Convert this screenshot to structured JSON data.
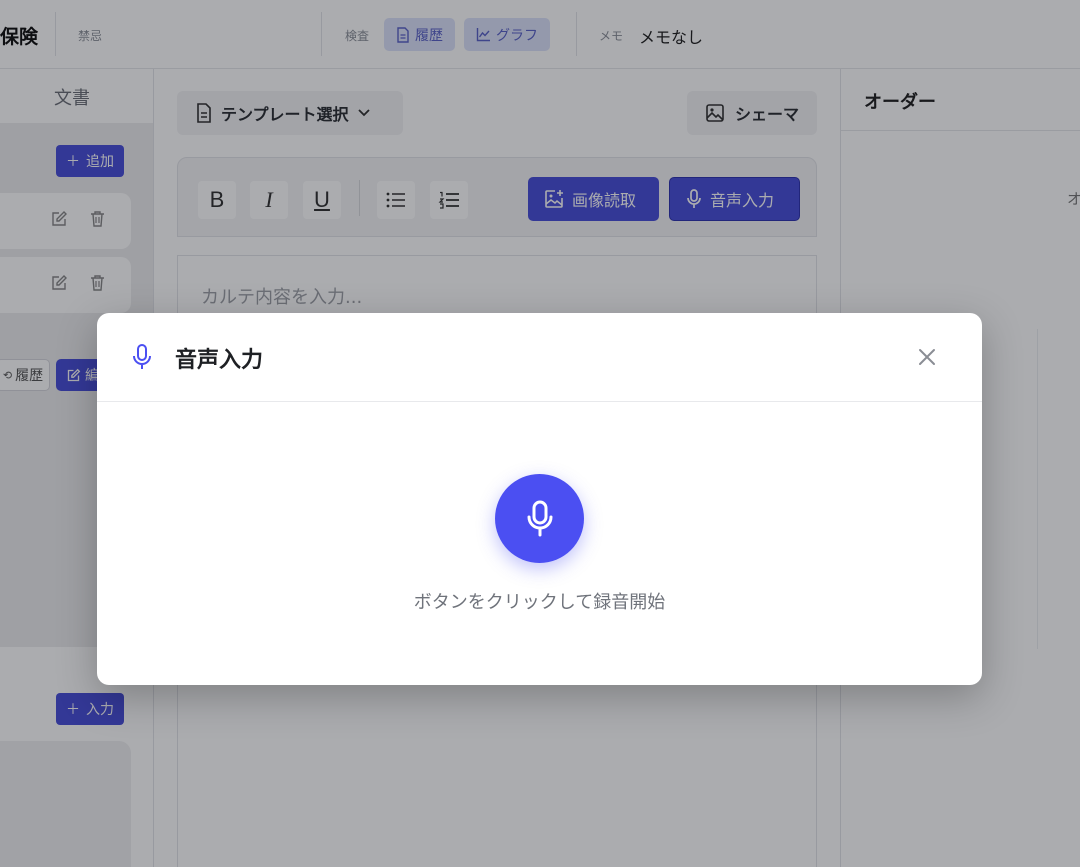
{
  "header": {
    "title": "保険",
    "tag": "禁忌",
    "exam_label": "検査",
    "chips": [
      {
        "label": "履歴",
        "icon": "document-icon"
      },
      {
        "label": "グラフ",
        "icon": "line-chart-icon"
      }
    ],
    "memo_label": "メモ",
    "memo_value": "メモなし"
  },
  "left": {
    "tab": "文書",
    "add_label": "追加",
    "history_label": "履歴",
    "edit_label": "編",
    "input_label": "入力"
  },
  "editor": {
    "template_label": "テンプレート選択",
    "schema_label": "シェーマ",
    "format_buttons": [
      "B",
      "I",
      "U"
    ],
    "image_read_label": "画像読取",
    "voice_input_label": "音声入力",
    "placeholder": "カルテ内容を入力..."
  },
  "right": {
    "title": "オーダー",
    "stub_text": "オ"
  },
  "modal": {
    "title": "音声入力",
    "hint": "ボタンをクリックして録音開始"
  },
  "colors": {
    "accent": "#4a4fd9",
    "record_button": "#4b4ff2",
    "chip_bg": "#dde3fb",
    "overlay": "rgba(10,12,20,0.34)"
  }
}
